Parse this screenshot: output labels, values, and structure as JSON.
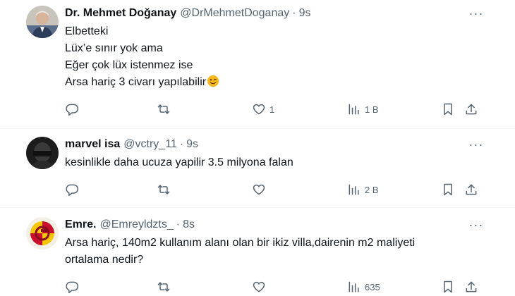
{
  "tweets": [
    {
      "author": "Dr. Mehmet Doğanay",
      "handle": "@DrMehmetDoganay",
      "time": "9s",
      "lines": [
        "Elbetteki",
        "Lüx’e sınır yok ama",
        "Eğer çok lüx istenmez ise",
        "Arsa hariç 3 civarı yapılabilir"
      ],
      "emoji": "winking-face",
      "reply_count": "",
      "retweet_count": "",
      "like_count": "1",
      "views": "1 B"
    },
    {
      "author": "marvel isa",
      "handle": "@vctry_11",
      "time": "9s",
      "lines": [
        "kesinlikle daha ucuza yapilir 3.5 milyona falan"
      ],
      "reply_count": "",
      "retweet_count": "",
      "like_count": "",
      "views": "2 B"
    },
    {
      "author": "Emre.",
      "handle": "@Emreyldzts_",
      "time": "8s",
      "lines": [
        "Arsa hariç, 140m2 kullanım alanı olan bir ikiz villa,dairenin m2 maliyeti",
        "ortalama nedir?"
      ],
      "reply_count": "",
      "retweet_count": "",
      "like_count": "",
      "views": "635"
    }
  ],
  "separator": "·",
  "icons": {
    "reply": "reply-icon",
    "retweet": "retweet-icon",
    "like": "heart-icon",
    "views": "views-icon",
    "bookmark": "bookmark-icon",
    "share": "share-icon",
    "more": "more-icon"
  },
  "colors": {
    "text": "#0f1419",
    "muted": "#536471",
    "divider": "#eff3f4"
  }
}
